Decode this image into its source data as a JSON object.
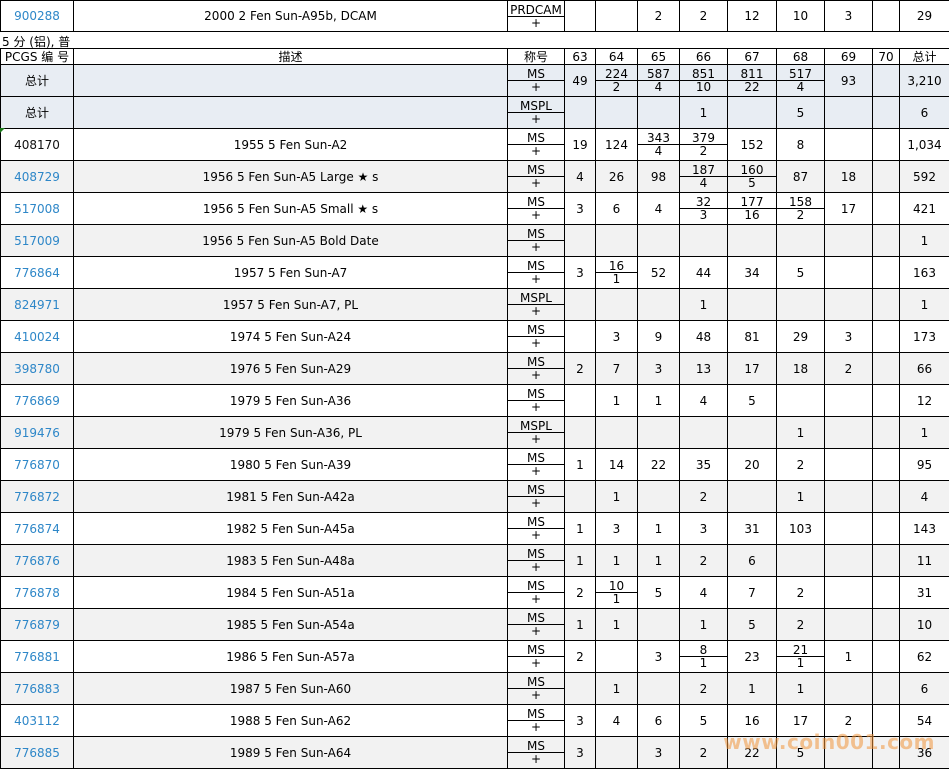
{
  "top_row": {
    "pcgs": "900288",
    "desc": "2000 2 Fen Sun-A95b, DCAM",
    "des_top": "PRDCAM",
    "des_bot": "+",
    "g63": "",
    "g64": "",
    "g65": "2",
    "g66": "2",
    "g67": "12",
    "g68": "10",
    "g69": "3",
    "g70": "",
    "total": "29"
  },
  "section_title": "5 分 (铝), 普",
  "headers": {
    "pcgs": "PCGS 编 号",
    "desc": "描述",
    "des": "称号",
    "g63": "63",
    "g64": "64",
    "g65": "65",
    "g66": "66",
    "g67": "67",
    "g68": "68",
    "g69": "69",
    "g70": "70",
    "total": "总计"
  },
  "summary": [
    {
      "label": "总计",
      "des_top": "MS",
      "des_bot": "+",
      "cells": [
        [
          "49",
          ""
        ],
        [
          "224",
          "2"
        ],
        [
          "587",
          "4"
        ],
        [
          "851",
          "10"
        ],
        [
          "811",
          "22"
        ],
        [
          "517",
          "4"
        ],
        [
          "93",
          ""
        ],
        [
          "",
          ""
        ]
      ],
      "total": "3,210"
    },
    {
      "label": "总计",
      "des_top": "MSPL",
      "des_bot": "+",
      "cells": [
        [
          "",
          ""
        ],
        [
          "",
          ""
        ],
        [
          "",
          ""
        ],
        [
          "1",
          ""
        ],
        [
          "",
          ""
        ],
        [
          "5",
          ""
        ],
        [
          "",
          ""
        ],
        [
          "",
          ""
        ]
      ],
      "total": "6"
    }
  ],
  "rows": [
    {
      "pcgs": "408170",
      "link": false,
      "desc": "1955 5 Fen Sun-A2",
      "des_top": "MS",
      "des_bot": "+",
      "cells": [
        [
          "19",
          ""
        ],
        [
          "124",
          ""
        ],
        [
          "343",
          "4"
        ],
        [
          "379",
          "2"
        ],
        [
          "152",
          ""
        ],
        [
          "8",
          ""
        ],
        [
          "",
          ""
        ],
        [
          "",
          ""
        ]
      ],
      "total": "1,034"
    },
    {
      "pcgs": "408729",
      "link": true,
      "desc": "1956 5 Fen Sun-A5 Large ★ s",
      "des_top": "MS",
      "des_bot": "+",
      "cells": [
        [
          "4",
          ""
        ],
        [
          "26",
          ""
        ],
        [
          "98",
          ""
        ],
        [
          "187",
          "4"
        ],
        [
          "160",
          "5"
        ],
        [
          "87",
          ""
        ],
        [
          "18",
          ""
        ],
        [
          "",
          ""
        ]
      ],
      "total": "592"
    },
    {
      "pcgs": "517008",
      "link": true,
      "desc": "1956 5 Fen Sun-A5 Small ★ s",
      "des_top": "MS",
      "des_bot": "+",
      "cells": [
        [
          "3",
          ""
        ],
        [
          "6",
          ""
        ],
        [
          "4",
          ""
        ],
        [
          "32",
          "3"
        ],
        [
          "177",
          "16"
        ],
        [
          "158",
          "2"
        ],
        [
          "17",
          ""
        ],
        [
          "",
          ""
        ]
      ],
      "total": "421"
    },
    {
      "pcgs": "517009",
      "link": true,
      "desc": "1956 5 Fen Sun-A5 Bold Date",
      "des_top": "MS",
      "des_bot": "+",
      "cells": [
        [
          "",
          ""
        ],
        [
          "",
          ""
        ],
        [
          "",
          ""
        ],
        [
          "",
          ""
        ],
        [
          "",
          ""
        ],
        [
          "",
          ""
        ],
        [
          "",
          ""
        ],
        [
          "",
          ""
        ]
      ],
      "total": "1"
    },
    {
      "pcgs": "776864",
      "link": true,
      "desc": "1957 5 Fen Sun-A7",
      "des_top": "MS",
      "des_bot": "+",
      "cells": [
        [
          "3",
          ""
        ],
        [
          "16",
          "1"
        ],
        [
          "52",
          ""
        ],
        [
          "44",
          ""
        ],
        [
          "34",
          ""
        ],
        [
          "5",
          ""
        ],
        [
          "",
          ""
        ],
        [
          "",
          ""
        ]
      ],
      "total": "163"
    },
    {
      "pcgs": "824971",
      "link": true,
      "desc": "1957 5 Fen Sun-A7, PL",
      "des_top": "MSPL",
      "des_bot": "+",
      "cells": [
        [
          "",
          ""
        ],
        [
          "",
          ""
        ],
        [
          "",
          ""
        ],
        [
          "1",
          ""
        ],
        [
          "",
          ""
        ],
        [
          "",
          ""
        ],
        [
          "",
          ""
        ],
        [
          "",
          ""
        ]
      ],
      "total": "1"
    },
    {
      "pcgs": "410024",
      "link": true,
      "desc": "1974 5 Fen Sun-A24",
      "des_top": "MS",
      "des_bot": "+",
      "cells": [
        [
          "",
          ""
        ],
        [
          "3",
          ""
        ],
        [
          "9",
          ""
        ],
        [
          "48",
          ""
        ],
        [
          "81",
          ""
        ],
        [
          "29",
          ""
        ],
        [
          "3",
          ""
        ],
        [
          "",
          ""
        ]
      ],
      "total": "173"
    },
    {
      "pcgs": "398780",
      "link": true,
      "desc": "1976 5 Fen Sun-A29",
      "des_top": "MS",
      "des_bot": "+",
      "cells": [
        [
          "2",
          ""
        ],
        [
          "7",
          ""
        ],
        [
          "3",
          ""
        ],
        [
          "13",
          ""
        ],
        [
          "17",
          ""
        ],
        [
          "18",
          ""
        ],
        [
          "2",
          ""
        ],
        [
          "",
          ""
        ]
      ],
      "total": "66"
    },
    {
      "pcgs": "776869",
      "link": true,
      "desc": "1979 5 Fen Sun-A36",
      "des_top": "MS",
      "des_bot": "+",
      "cells": [
        [
          "",
          ""
        ],
        [
          "1",
          ""
        ],
        [
          "1",
          ""
        ],
        [
          "4",
          ""
        ],
        [
          "5",
          ""
        ],
        [
          "",
          ""
        ],
        [
          "",
          ""
        ],
        [
          "",
          ""
        ]
      ],
      "total": "12"
    },
    {
      "pcgs": "919476",
      "link": true,
      "desc": "1979 5 Fen Sun-A36, PL",
      "des_top": "MSPL",
      "des_bot": "+",
      "cells": [
        [
          "",
          ""
        ],
        [
          "",
          ""
        ],
        [
          "",
          ""
        ],
        [
          "",
          ""
        ],
        [
          "",
          ""
        ],
        [
          "1",
          ""
        ],
        [
          "",
          ""
        ],
        [
          "",
          ""
        ]
      ],
      "total": "1"
    },
    {
      "pcgs": "776870",
      "link": true,
      "desc": "1980 5 Fen Sun-A39",
      "des_top": "MS",
      "des_bot": "+",
      "cells": [
        [
          "1",
          ""
        ],
        [
          "14",
          ""
        ],
        [
          "22",
          ""
        ],
        [
          "35",
          ""
        ],
        [
          "20",
          ""
        ],
        [
          "2",
          ""
        ],
        [
          "",
          ""
        ],
        [
          "",
          ""
        ]
      ],
      "total": "95"
    },
    {
      "pcgs": "776872",
      "link": true,
      "desc": "1981 5 Fen Sun-A42a",
      "des_top": "MS",
      "des_bot": "+",
      "cells": [
        [
          "",
          ""
        ],
        [
          "1",
          ""
        ],
        [
          "",
          ""
        ],
        [
          "2",
          ""
        ],
        [
          "",
          ""
        ],
        [
          "1",
          ""
        ],
        [
          "",
          ""
        ],
        [
          "",
          ""
        ]
      ],
      "total": "4"
    },
    {
      "pcgs": "776874",
      "link": true,
      "desc": "1982 5 Fen Sun-A45a",
      "des_top": "MS",
      "des_bot": "+",
      "cells": [
        [
          "1",
          ""
        ],
        [
          "3",
          ""
        ],
        [
          "1",
          ""
        ],
        [
          "3",
          ""
        ],
        [
          "31",
          ""
        ],
        [
          "103",
          ""
        ],
        [
          "",
          ""
        ],
        [
          "",
          ""
        ]
      ],
      "total": "143"
    },
    {
      "pcgs": "776876",
      "link": true,
      "desc": "1983 5 Fen Sun-A48a",
      "des_top": "MS",
      "des_bot": "+",
      "cells": [
        [
          "1",
          ""
        ],
        [
          "1",
          ""
        ],
        [
          "1",
          ""
        ],
        [
          "2",
          ""
        ],
        [
          "6",
          ""
        ],
        [
          "",
          ""
        ],
        [
          "",
          ""
        ],
        [
          "",
          ""
        ]
      ],
      "total": "11"
    },
    {
      "pcgs": "776878",
      "link": true,
      "desc": "1984 5 Fen Sun-A51a",
      "des_top": "MS",
      "des_bot": "+",
      "cells": [
        [
          "2",
          ""
        ],
        [
          "10",
          "1"
        ],
        [
          "5",
          ""
        ],
        [
          "4",
          ""
        ],
        [
          "7",
          ""
        ],
        [
          "2",
          ""
        ],
        [
          "",
          ""
        ],
        [
          "",
          ""
        ]
      ],
      "total": "31"
    },
    {
      "pcgs": "776879",
      "link": true,
      "desc": "1985 5 Fen Sun-A54a",
      "des_top": "MS",
      "des_bot": "+",
      "cells": [
        [
          "1",
          ""
        ],
        [
          "1",
          ""
        ],
        [
          "",
          ""
        ],
        [
          "1",
          ""
        ],
        [
          "5",
          ""
        ],
        [
          "2",
          ""
        ],
        [
          "",
          ""
        ],
        [
          "",
          ""
        ]
      ],
      "total": "10"
    },
    {
      "pcgs": "776881",
      "link": true,
      "desc": "1986 5 Fen Sun-A57a",
      "des_top": "MS",
      "des_bot": "+",
      "cells": [
        [
          "2",
          ""
        ],
        [
          "",
          ""
        ],
        [
          "3",
          ""
        ],
        [
          "8",
          "1"
        ],
        [
          "23",
          ""
        ],
        [
          "21",
          "1"
        ],
        [
          "1",
          ""
        ],
        [
          "",
          ""
        ]
      ],
      "total": "62"
    },
    {
      "pcgs": "776883",
      "link": true,
      "desc": "1987 5 Fen Sun-A60",
      "des_top": "MS",
      "des_bot": "+",
      "cells": [
        [
          "",
          ""
        ],
        [
          "1",
          ""
        ],
        [
          "",
          ""
        ],
        [
          "2",
          ""
        ],
        [
          "1",
          ""
        ],
        [
          "1",
          ""
        ],
        [
          "",
          ""
        ],
        [
          "",
          ""
        ]
      ],
      "total": "6"
    },
    {
      "pcgs": "403112",
      "link": true,
      "desc": "1988 5 Fen Sun-A62",
      "des_top": "MS",
      "des_bot": "+",
      "cells": [
        [
          "3",
          ""
        ],
        [
          "4",
          ""
        ],
        [
          "6",
          ""
        ],
        [
          "5",
          ""
        ],
        [
          "16",
          ""
        ],
        [
          "17",
          ""
        ],
        [
          "2",
          ""
        ],
        [
          "",
          ""
        ]
      ],
      "total": "54"
    },
    {
      "pcgs": "776885",
      "link": true,
      "desc": "1989 5 Fen Sun-A64",
      "des_top": "MS",
      "des_bot": "+",
      "cells": [
        [
          "3",
          ""
        ],
        [
          "",
          ""
        ],
        [
          "3",
          ""
        ],
        [
          "2",
          ""
        ],
        [
          "22",
          ""
        ],
        [
          "5",
          ""
        ],
        [
          "",
          ""
        ],
        [
          "",
          ""
        ]
      ],
      "total": "36"
    }
  ],
  "watermark": "www.coin001.com",
  "colors": {
    "link": "#2e87c8",
    "summary_bg": "#e8edf3",
    "alt_row_bg": "#f2f2f2"
  }
}
